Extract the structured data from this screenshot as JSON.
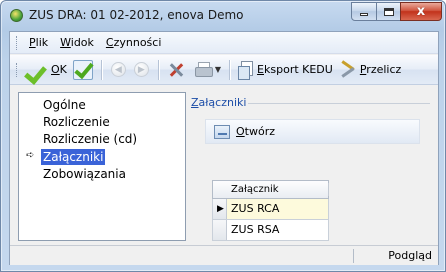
{
  "window": {
    "title": "ZUS DRA: 01 02-2012, enova Demo",
    "close_symbol": "x",
    "colors": {
      "titlebar": "#bcd2ea",
      "close_button": "#c2321b",
      "selection": "#3a63d8"
    }
  },
  "menu": {
    "items": [
      "Plik",
      "Widok",
      "Czynności"
    ]
  },
  "toolbar": {
    "ok_label": "OK",
    "export_kedu_label": "Eksport KEDU",
    "przelicz_label": "Przelicz",
    "icons": [
      "check-icon",
      "approve-doc-icon",
      "back-icon",
      "forward-icon",
      "tools-icon",
      "print-icon",
      "export-kedu-icon",
      "przelicz-icon"
    ]
  },
  "tree": {
    "items": [
      "Ogólne",
      "Rozliczenie",
      "Rozliczenie (cd)",
      "Załączniki",
      "Zobowiązania"
    ],
    "selected": "Załączniki"
  },
  "panel": {
    "group_title": "Załączniki",
    "open_label": "Otwórz",
    "grid": {
      "column": "Załącznik",
      "rows": [
        "ZUS RCA",
        "ZUS RSA"
      ],
      "current_row": "ZUS RCA"
    }
  },
  "status": {
    "mode": "Podgląd"
  }
}
